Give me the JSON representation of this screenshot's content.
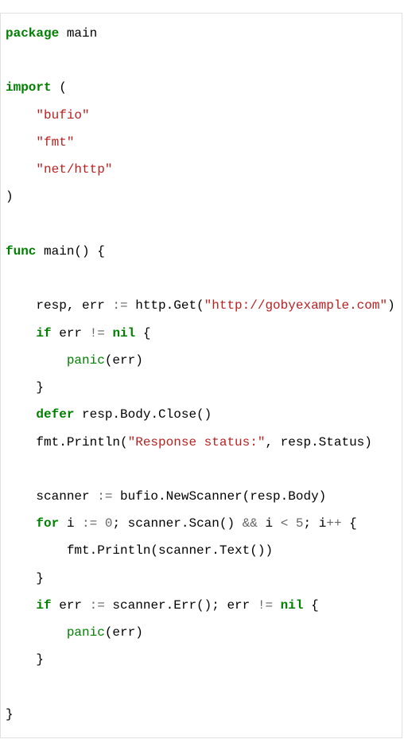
{
  "code": {
    "kw_package": "package",
    "pkg_name": " main",
    "kw_import": "import",
    "paren_open": " (",
    "imp1": "\"bufio\"",
    "imp2": "\"fmt\"",
    "imp3": "\"net/http\"",
    "paren_close": ")",
    "kw_func": "func",
    "func_sig": " main() {",
    "l_resp": "    resp, err ",
    "op_assign1": ":=",
    "l_httpget": " http.Get(",
    "url": "\"http://gobyexample.com\"",
    "l_httpget_close": ")",
    "kw_if1": "if",
    "l_if1": " err ",
    "op_neq1": "!=",
    "sp1": " ",
    "kw_nil1": "nil",
    "l_if1_brace": " {",
    "bi_panic1": "panic",
    "l_panic1": "(err)",
    "l_brace1": "    }",
    "kw_defer": "defer",
    "l_defer": " resp.Body.Close()",
    "l_println1a": "    fmt.Println(",
    "str_status": "\"Response status:\"",
    "l_println1b": ", resp.Status)",
    "l_scanner": "    scanner ",
    "op_assign2": ":=",
    "l_newscanner": " bufio.NewScanner(resp.Body)",
    "kw_for": "for",
    "l_for_i": " i ",
    "op_assign3": ":=",
    "sp2": " ",
    "num_zero": "0",
    "l_for_scan": "; scanner.Scan() ",
    "op_and": "&&",
    "l_for_ilt": " i ",
    "op_lt": "<",
    "sp3": " ",
    "num_five": "5",
    "l_for_inc": "; i",
    "op_inc": "++",
    "l_for_brace": " {",
    "l_println2": "        fmt.Println(scanner.Text())",
    "l_brace2": "    }",
    "kw_if2": "if",
    "l_if2a": " err ",
    "op_assign4": ":=",
    "l_if2b": " scanner.Err(); err ",
    "op_neq2": "!=",
    "sp4": " ",
    "kw_nil2": "nil",
    "l_if2_brace": " {",
    "bi_panic2": "panic",
    "l_panic2": "(err)",
    "l_brace3": "    }",
    "l_close": "}"
  }
}
